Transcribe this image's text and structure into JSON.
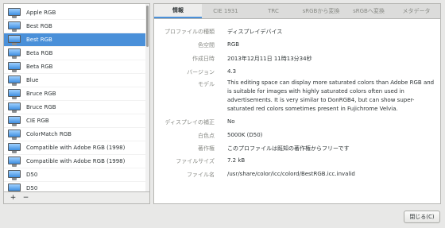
{
  "profiles": [
    "Apple RGB",
    "Best RGB",
    "Best RGB",
    "Beta RGB",
    "Beta RGB",
    "Blue",
    "Bruce RGB",
    "Bruce RGB",
    "CIE RGB",
    "ColorMatch RGB",
    "Compatible with Adobe RGB (1998)",
    "Compatible with Adobe RGB (1998)",
    "D50",
    "D50"
  ],
  "selected_index": 2,
  "toolbar": {
    "add_label": "+",
    "remove_label": "−"
  },
  "tabs": [
    "情報",
    "CIE 1931",
    "TRC",
    "sRGBから変換",
    "sRGBへ変換",
    "メタデータ"
  ],
  "active_tab": 0,
  "fields": [
    {
      "label": "プロファイルの種類",
      "value": "ディスプレイデバイス"
    },
    {
      "label": "色空間",
      "value": "RGB"
    },
    {
      "label": "作成日時",
      "value": "2013年12月11日 11時13分34秒"
    },
    {
      "label": "バージョン",
      "value": "4.3"
    },
    {
      "label": "モデル",
      "value": "This editing space can display more saturated colors than Adobe RGB and is suitable for images with highly saturated colors often used in advertisements. It is very similar to DonRGB4, but can show super-saturated red colors sometimes present in Fujichrome Velvia."
    },
    {
      "label": "ディスプレイの補正",
      "value": "No"
    },
    {
      "label": "白色点",
      "value": "5000K (D50)"
    },
    {
      "label": "著作権",
      "value": "このプロファイルは既知の著作権からフリーです"
    },
    {
      "label": "ファイルサイズ",
      "value": "7.2 kB"
    },
    {
      "label": "ファイル名",
      "value": "/usr/share/color/icc/colord/BestRGB.icc.invalid"
    }
  ],
  "close_label": "閉じる(C)",
  "colors": {
    "selection": "#4a90d9",
    "window_bg": "#e8e8e7"
  }
}
